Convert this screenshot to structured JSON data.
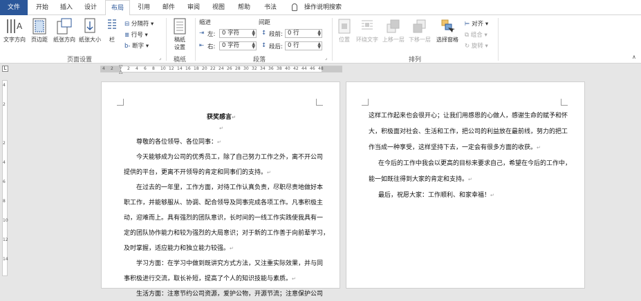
{
  "tabs": [
    {
      "label": "文件",
      "state": "file"
    },
    {
      "label": "开始",
      "state": ""
    },
    {
      "label": "插入",
      "state": ""
    },
    {
      "label": "设计",
      "state": ""
    },
    {
      "label": "布局",
      "state": "active"
    },
    {
      "label": "引用",
      "state": ""
    },
    {
      "label": "邮件",
      "state": ""
    },
    {
      "label": "审阅",
      "state": ""
    },
    {
      "label": "视图",
      "state": ""
    },
    {
      "label": "帮助",
      "state": ""
    },
    {
      "label": "书法",
      "state": ""
    }
  ],
  "tell_me": "操作说明搜索",
  "ribbon": {
    "page_setup": {
      "label": "页面设置",
      "text_direction": "文字方向",
      "margins": "页边距",
      "orientation": "纸张方向",
      "size": "纸张大小",
      "columns": "栏",
      "breaks": "分隔符",
      "line_numbers": "行号",
      "hyphenation": "断字"
    },
    "draft": {
      "label": "稿纸",
      "btn_line1": "稿纸",
      "btn_line2": "设置"
    },
    "paragraph": {
      "label": "段落",
      "indent_header": "缩进",
      "spacing_header": "间距",
      "left_label": "左:",
      "left_value": "0 字符",
      "right_label": "右:",
      "right_value": "0 字符",
      "before_label": "段前:",
      "before_value": "0 行",
      "after_label": "段后:",
      "after_value": "0 行"
    },
    "arrange": {
      "label": "排列",
      "position": "位置",
      "wrap_text": "环绕文字",
      "bring_forward": "上移一层",
      "send_backward": "下移一层",
      "selection_pane": "选择窗格",
      "align": "对齐",
      "group": "组合",
      "rotate": "旋转"
    }
  },
  "ruler": {
    "numbers": [
      "4",
      "2",
      "",
      "2",
      "4",
      "6",
      "8",
      "10",
      "12",
      "14",
      "16",
      "18",
      "20",
      "22",
      "24",
      "26",
      "28",
      "30",
      "32",
      "34",
      "36",
      "38",
      "40",
      "42",
      "44",
      "46",
      "48"
    ]
  },
  "vruler": {
    "numbers": [
      "4",
      "2",
      "",
      "2",
      "4",
      "6",
      "8",
      "10",
      "12",
      "14"
    ]
  },
  "doc": {
    "title": "获奖感言",
    "left_lines": [
      "尊敬的各位领导、各位同事：",
      "今天能够成为公司的优秀员工，除了自己努力工作之外，离不开公司",
      "提供的平台，更离不开领导的肯定和同事们的支持。",
      "在过去的一年里，工作方面，对待工作认真负责，尽职尽责地做好本",
      "职工作，并能够服从、协调、配合领导及同事完成各项工作。凡事积极主",
      "动，迎难而上。具有强烈的团队意识，长时间的一线工作实践使我具有一",
      "定的团队协作能力和较为强烈的大局意识；对于新的工作善于向前辈学习，",
      "及时掌握，适应能力和独立能力较强。",
      "学习方面：在学习中做到既讲究方式方法，又注重实际效果，并与同",
      "事积极进行交流，取长补短，提高了个人的知识技能与素质。",
      "生活方面：注意节约公司资源，爱护公物，开源节流；注意保护公司"
    ],
    "right_lines": [
      "这样工作起来也会很开心；让我们用感恩的心做人，感谢生命的赋予和怀",
      "大，积极面对社会、生活和工作，把公司的利益放在最前线，努力的把工",
      "作当成一种享受，这样坚持下去，一定会有很多方面的收获。",
      "在今后的工作中我会以更高的目标来要求自己，希望在今后的工作中，",
      "能一如既往得到大家的肯定和支持。",
      "最后，祝愿大家：工作顺利、和家幸福！"
    ]
  }
}
